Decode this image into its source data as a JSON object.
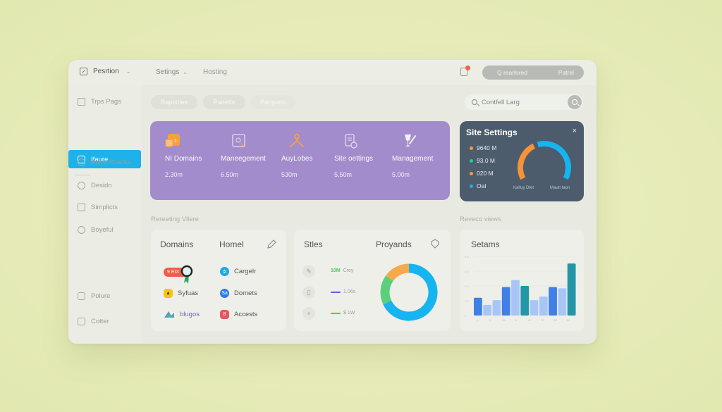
{
  "topbar": {
    "brand": "Pesrtion",
    "nav": [
      {
        "label": "Setings",
        "has_dropdown": true
      },
      {
        "label": "Hosting",
        "has_dropdown": false
      }
    ],
    "notification_icon": "clipboard-bell-icon",
    "pill_left": "Q rearlored",
    "pill_right": "Patrel"
  },
  "sidebar": {
    "items": [
      {
        "label": "Trps Pags",
        "icon": "list-icon",
        "active": false
      },
      {
        "label": "Ifaure",
        "icon": "inbox-icon",
        "active": true
      },
      {
        "label": "Appe Roacks",
        "icon": "chat-icon",
        "active": false
      },
      {
        "label": "Desidn",
        "icon": "clock-icon",
        "active": false
      },
      {
        "label": "Simplicts",
        "icon": "columns-icon",
        "active": false
      },
      {
        "label": "Boyeful",
        "icon": "badge-icon",
        "active": false
      },
      {
        "label": "Polure",
        "icon": "bag-icon",
        "active": false
      },
      {
        "label": "Cotter",
        "icon": "card-icon",
        "active": false
      }
    ]
  },
  "filters": {
    "chips": [
      "Raporties",
      "Parletts",
      "Parquats"
    ],
    "search": {
      "value": "Contfell Larg",
      "placeholder": "Contfell Larg"
    }
  },
  "metrics": {
    "background": "#a28ccb",
    "items": [
      {
        "label": "NI Domains",
        "value": "2.30m",
        "icon": "domains-icon"
      },
      {
        "label": "Maneegement",
        "value": "6.50m",
        "icon": "touch-screen-icon"
      },
      {
        "label": "AuyLobes",
        "value": "530m",
        "icon": "hanger-icon"
      },
      {
        "label": "Site oettings",
        "value": "5.50m",
        "icon": "document-gear-icon"
      },
      {
        "label": "Management",
        "value": "5.00m",
        "icon": "glass-pen-icon"
      }
    ]
  },
  "site_settings": {
    "title": "Site Settings",
    "close_label": "×",
    "legend": [
      {
        "label": "9640 M",
        "color": "#f59a3c"
      },
      {
        "label": "93.0 M",
        "color": "#22c7a8"
      },
      {
        "label": "020 M",
        "color": "#f59a3c"
      },
      {
        "label": "Oal",
        "color": "#1eb2ea"
      }
    ],
    "gauges": [
      {
        "caption": "Kalluy Dtet",
        "color": "#f5923a",
        "fraction": 0.42
      },
      {
        "caption": "Mautt taon",
        "color": "#16b4f0",
        "fraction": 0.58
      }
    ]
  },
  "sections": {
    "left_label": "Rereeting Vilere",
    "right_label": "Reveco views"
  },
  "domains_card": {
    "title": "Domains",
    "subtitle": "Homel",
    "edit_icon": "pencil-icon",
    "badge": "9 EIX",
    "apps": [
      {
        "label": "Cargelr",
        "color": "#1da8e8",
        "glyph": "✲"
      },
      {
        "label": "Syfuas",
        "color": "#f5c518",
        "glyph": "▲"
      },
      {
        "label": "Domets",
        "color": "#2f7ae5",
        "glyph": "Sa"
      },
      {
        "label": "blugos",
        "color": "#7a5ed0",
        "glyph": "▲"
      },
      {
        "label": "Accests",
        "color": "#e85560",
        "glyph": "8"
      }
    ]
  },
  "sites_card": {
    "title": "Stles",
    "subtitle": "Proyands",
    "tag_icon": "tag-icon",
    "rows": [
      {
        "icon": "feather-icon",
        "value": "10M",
        "label": "Crey",
        "color": "#4cc96a"
      },
      {
        "icon": "tablet-icon",
        "value": "",
        "label": "1.06s",
        "color": "#6a5bd6"
      },
      {
        "icon": "plus-icon",
        "value": "",
        "label": "$ 1W",
        "color": "#4cc96a"
      }
    ]
  },
  "chart_data": [
    {
      "type": "pie",
      "title": "Proyands",
      "donut": true,
      "categories": [
        "Blue",
        "Green",
        "Orange"
      ],
      "values": [
        68,
        17,
        15
      ],
      "colors": [
        "#16b4f0",
        "#5ad07a",
        "#f7a84a"
      ]
    },
    {
      "type": "bar",
      "title": "Setams",
      "categories": [
        "1",
        "2",
        "3",
        "4",
        "5",
        "6",
        "7",
        "8",
        "9",
        "10",
        "11",
        "12"
      ],
      "values": [
        1.5,
        0.9,
        1.3,
        2.4,
        3.0,
        2.5,
        1.3,
        1.6,
        2.4,
        2.3,
        4.4
      ],
      "x_ticks": [
        "1",
        "2",
        "30",
        "8",
        "40",
        "50",
        "55",
        "50"
      ],
      "y_ticks": [
        "0",
        "1.2",
        "2.4",
        "3.6",
        "5.0"
      ],
      "ylim": [
        0,
        5
      ],
      "colors": [
        "#3f7fe6",
        "#a8c6f5",
        "#a8c6f5",
        "#3f7fe6",
        "#a8c6f5",
        "#2396a8",
        "#a8c6f5",
        "#a8c6f5",
        "#3f7fe6",
        "#a8c6f5",
        "#2396a8"
      ],
      "grid": true
    }
  ]
}
